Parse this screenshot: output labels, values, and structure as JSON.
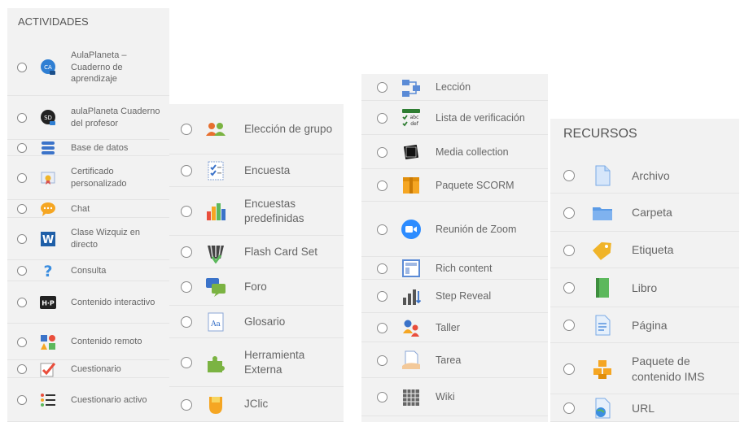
{
  "activities_panel": {
    "title": "ACTIVIDADES",
    "items": [
      {
        "label": "AulaPlaneta – Cuaderno de aprendizaje",
        "icon": "aulaplaneta-ca-icon"
      },
      {
        "label": "aulaPlaneta Cuaderno del profesor",
        "icon": "aulaplaneta-sd-icon"
      },
      {
        "label": "Base de datos",
        "icon": "database-icon"
      },
      {
        "label": "Certificado personalizado",
        "icon": "certificate-icon"
      },
      {
        "label": "Chat",
        "icon": "chat-icon"
      },
      {
        "label": "Clase Wizquiz en directo",
        "icon": "wizquiz-icon"
      },
      {
        "label": "Consulta",
        "icon": "question-icon"
      },
      {
        "label": "Contenido interactivo",
        "icon": "h5p-icon"
      },
      {
        "label": "Contenido remoto",
        "icon": "remote-content-icon"
      },
      {
        "label": "Cuestionario",
        "icon": "quiz-icon"
      },
      {
        "label": "Cuestionario activo",
        "icon": "active-quiz-icon"
      }
    ],
    "items2": [
      {
        "label": "Elección de grupo",
        "icon": "group-choice-icon"
      },
      {
        "label": "Encuesta",
        "icon": "survey-icon"
      },
      {
        "label": "Encuestas predefinidas",
        "icon": "predefined-surveys-icon"
      },
      {
        "label": "Flash Card Set",
        "icon": "flash-card-icon"
      },
      {
        "label": "Foro",
        "icon": "forum-icon"
      },
      {
        "label": "Glosario",
        "icon": "glossary-icon"
      },
      {
        "label": "Herramienta Externa",
        "icon": "external-tool-icon"
      },
      {
        "label": "JClic",
        "icon": "jclic-icon"
      }
    ],
    "items3": [
      {
        "label": "Lección",
        "icon": "lesson-icon"
      },
      {
        "label": "Lista de verificación",
        "icon": "checklist-icon"
      },
      {
        "label": "Media collection",
        "icon": "media-collection-icon"
      },
      {
        "label": "Paquete SCORM",
        "icon": "scorm-package-icon"
      },
      {
        "label": "Reunión de Zoom",
        "icon": "zoom-icon"
      },
      {
        "label": "Rich content",
        "icon": "rich-content-icon"
      },
      {
        "label": "Step Reveal",
        "icon": "step-reveal-icon"
      },
      {
        "label": "Taller",
        "icon": "workshop-icon"
      },
      {
        "label": "Tarea",
        "icon": "assignment-icon"
      },
      {
        "label": "Wiki",
        "icon": "wiki-icon"
      }
    ]
  },
  "resources_panel": {
    "title": "RECURSOS",
    "items": [
      {
        "label": "Archivo",
        "icon": "file-icon"
      },
      {
        "label": "Carpeta",
        "icon": "folder-icon"
      },
      {
        "label": "Etiqueta",
        "icon": "label-tag-icon"
      },
      {
        "label": "Libro",
        "icon": "book-icon"
      },
      {
        "label": "Página",
        "icon": "page-icon"
      },
      {
        "label": "Paquete de contenido IMS",
        "icon": "ims-package-icon"
      },
      {
        "label": "URL",
        "icon": "url-icon"
      }
    ]
  },
  "colors": {
    "panel_bg": "#f2f2f2",
    "text": "#666666",
    "accent_blue": "#1f6fc4",
    "zoom_blue": "#2d8cff"
  }
}
